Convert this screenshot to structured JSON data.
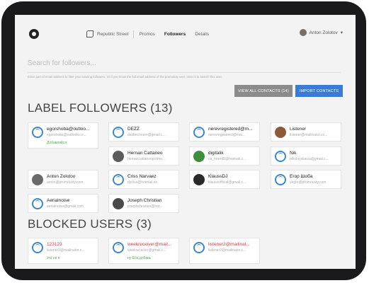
{
  "nav": {
    "brand": "Republic Street",
    "items": [
      "Promos",
      "Followers",
      "Details"
    ],
    "active": "Followers"
  },
  "user": {
    "name": "Anton Zolotov",
    "caret": "▾"
  },
  "search": {
    "placeholder": "Search for followers...",
    "hint": "Enter part of email address to filter your existing followers. Or if you know the full email address of the promoiuty user, enter it to search this user."
  },
  "buttons": {
    "view_all": "VIEW ALL CONTACTS (14)",
    "import": "IMPORT CONTACTS"
  },
  "followers_heading": "LABEL FOLLOWERS (13)",
  "blocked_heading": "BLOCKED USERS (3)",
  "followers": [
    {
      "name": "egorshoba@outloo...",
      "email": "egorshoba@outlook.co...",
      "note": "Добавляйся",
      "avatar": "default"
    },
    {
      "name": "DEZZ",
      "email": "dezbechnom@gmail.c...",
      "avatar": "default"
    },
    {
      "name": "nerevregistered@m...",
      "email": "nerevregistered@mai...",
      "avatar": "default"
    },
    {
      "name": "Listener",
      "email": "listener@mailinator.co...",
      "avatar": "photo",
      "avatar_color": "#8a5a3a"
    },
    {
      "name": "Hernan Cattaneo",
      "email": "hernancattaneopromo...",
      "avatar": "photo",
      "avatar_color": "#5c5c5c"
    },
    {
      "name": "digitalik",
      "email": "ca_forerd8@hotmail.c...",
      "avatar": "photo",
      "avatar_color": "#3f8f3a"
    },
    {
      "name": "Nik",
      "email": "nikolayskaiva@gmail.c...",
      "avatar": "default"
    },
    {
      "name": "Anton Zolotov",
      "email": "anton@promousty.com",
      "avatar": "photo",
      "avatar_color": "#6a6a6a"
    },
    {
      "name": "Criss Narvaez",
      "email": "djcriss@hotmail.es",
      "avatar": "default"
    },
    {
      "name": "KlaussDJ",
      "email": "klaussofficial@gmail.c...",
      "avatar": "photo",
      "avatar_color": "#2a2a2a"
    },
    {
      "name": "Егор Шоба",
      "email": "yegor@promousty.com",
      "avatar": "default"
    },
    {
      "name": "Aerialnoise",
      "email": "aerialnoise@gmail.com",
      "avatar": "default"
    },
    {
      "name": "Joseph Christian",
      "email": "josephchristian@hot...",
      "avatar": "photo",
      "avatar_color": "#4a4a4a"
    }
  ],
  "blocked": [
    {
      "name": "123123",
      "email": "listener3@mailinator.c...",
      "note": "это не я",
      "avatar": "default"
    },
    {
      "name": "weekreceiver@mail...",
      "email": "weekreceiver@gmail.c...",
      "note": "ну Ёба добавь",
      "avatar": "default"
    },
    {
      "name": "listener2@mailinat...",
      "email": "listener2@mailinator.c...",
      "avatar": "default"
    }
  ],
  "colors": {
    "accent": "#3a7bd5",
    "icon_blue": "#3d87cf",
    "blocked_red": "#d23b3b",
    "note_green": "#5aa85a"
  }
}
